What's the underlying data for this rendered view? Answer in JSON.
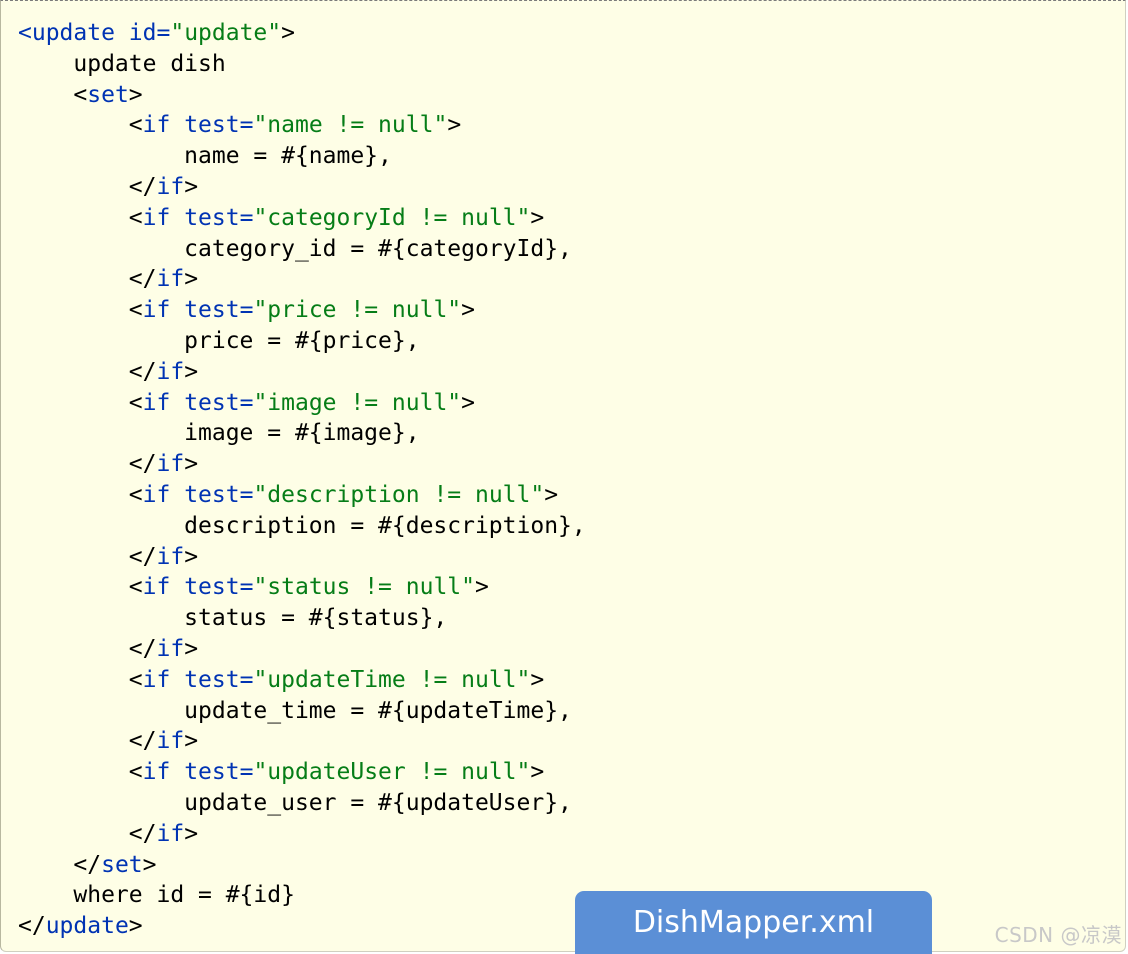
{
  "code": {
    "language": "xml",
    "lines": [
      [
        {
          "t": "tag",
          "v": "<update"
        },
        {
          "t": "text",
          "v": " "
        },
        {
          "t": "attr",
          "v": "id="
        },
        {
          "t": "str",
          "v": "\"update\""
        },
        {
          "t": "text",
          "v": ">"
        }
      ],
      [
        {
          "t": "text",
          "v": "    update dish"
        }
      ],
      [
        {
          "t": "text",
          "v": "    <"
        },
        {
          "t": "tag",
          "v": "set"
        },
        {
          "t": "text",
          "v": ">"
        }
      ],
      [
        {
          "t": "text",
          "v": "        <"
        },
        {
          "t": "tag",
          "v": "if"
        },
        {
          "t": "text",
          "v": " "
        },
        {
          "t": "attr",
          "v": "test="
        },
        {
          "t": "str",
          "v": "\"name != null\""
        },
        {
          "t": "text",
          "v": ">"
        }
      ],
      [
        {
          "t": "text",
          "v": "            name = #{name},"
        }
      ],
      [
        {
          "t": "text",
          "v": "        </"
        },
        {
          "t": "tag",
          "v": "if"
        },
        {
          "t": "text",
          "v": ">"
        }
      ],
      [
        {
          "t": "text",
          "v": "        <"
        },
        {
          "t": "tag",
          "v": "if"
        },
        {
          "t": "text",
          "v": " "
        },
        {
          "t": "attr",
          "v": "test="
        },
        {
          "t": "str",
          "v": "\"categoryId != null\""
        },
        {
          "t": "text",
          "v": ">"
        }
      ],
      [
        {
          "t": "text",
          "v": "            category_id = #{categoryId},"
        }
      ],
      [
        {
          "t": "text",
          "v": "        </"
        },
        {
          "t": "tag",
          "v": "if"
        },
        {
          "t": "text",
          "v": ">"
        }
      ],
      [
        {
          "t": "text",
          "v": "        <"
        },
        {
          "t": "tag",
          "v": "if"
        },
        {
          "t": "text",
          "v": " "
        },
        {
          "t": "attr",
          "v": "test="
        },
        {
          "t": "str",
          "v": "\"price != null\""
        },
        {
          "t": "text",
          "v": ">"
        }
      ],
      [
        {
          "t": "text",
          "v": "            price = #{price},"
        }
      ],
      [
        {
          "t": "text",
          "v": "        </"
        },
        {
          "t": "tag",
          "v": "if"
        },
        {
          "t": "text",
          "v": ">"
        }
      ],
      [
        {
          "t": "text",
          "v": "        <"
        },
        {
          "t": "tag",
          "v": "if"
        },
        {
          "t": "text",
          "v": " "
        },
        {
          "t": "attr",
          "v": "test="
        },
        {
          "t": "str",
          "v": "\"image != null\""
        },
        {
          "t": "text",
          "v": ">"
        }
      ],
      [
        {
          "t": "text",
          "v": "            image = #{image},"
        }
      ],
      [
        {
          "t": "text",
          "v": "        </"
        },
        {
          "t": "tag",
          "v": "if"
        },
        {
          "t": "text",
          "v": ">"
        }
      ],
      [
        {
          "t": "text",
          "v": "        <"
        },
        {
          "t": "tag",
          "v": "if"
        },
        {
          "t": "text",
          "v": " "
        },
        {
          "t": "attr",
          "v": "test="
        },
        {
          "t": "str",
          "v": "\"description != null\""
        },
        {
          "t": "text",
          "v": ">"
        }
      ],
      [
        {
          "t": "text",
          "v": "            description = #{description},"
        }
      ],
      [
        {
          "t": "text",
          "v": "        </"
        },
        {
          "t": "tag",
          "v": "if"
        },
        {
          "t": "text",
          "v": ">"
        }
      ],
      [
        {
          "t": "text",
          "v": "        <"
        },
        {
          "t": "tag",
          "v": "if"
        },
        {
          "t": "text",
          "v": " "
        },
        {
          "t": "attr",
          "v": "test="
        },
        {
          "t": "str",
          "v": "\"status != null\""
        },
        {
          "t": "text",
          "v": ">"
        }
      ],
      [
        {
          "t": "text",
          "v": "            status = #{status},"
        }
      ],
      [
        {
          "t": "text",
          "v": "        </"
        },
        {
          "t": "tag",
          "v": "if"
        },
        {
          "t": "text",
          "v": ">"
        }
      ],
      [
        {
          "t": "text",
          "v": "        <"
        },
        {
          "t": "tag",
          "v": "if"
        },
        {
          "t": "text",
          "v": " "
        },
        {
          "t": "attr",
          "v": "test="
        },
        {
          "t": "str",
          "v": "\"updateTime != null\""
        },
        {
          "t": "text",
          "v": ">"
        }
      ],
      [
        {
          "t": "text",
          "v": "            update_time = #{updateTime},"
        }
      ],
      [
        {
          "t": "text",
          "v": "        </"
        },
        {
          "t": "tag",
          "v": "if"
        },
        {
          "t": "text",
          "v": ">"
        }
      ],
      [
        {
          "t": "text",
          "v": "        <"
        },
        {
          "t": "tag",
          "v": "if"
        },
        {
          "t": "text",
          "v": " "
        },
        {
          "t": "attr",
          "v": "test="
        },
        {
          "t": "str",
          "v": "\"updateUser != null\""
        },
        {
          "t": "text",
          "v": ">"
        }
      ],
      [
        {
          "t": "text",
          "v": "            update_user = #{updateUser},"
        }
      ],
      [
        {
          "t": "text",
          "v": "        </"
        },
        {
          "t": "tag",
          "v": "if"
        },
        {
          "t": "text",
          "v": ">"
        }
      ],
      [
        {
          "t": "text",
          "v": "    </"
        },
        {
          "t": "tag",
          "v": "set"
        },
        {
          "t": "text",
          "v": ">"
        }
      ],
      [
        {
          "t": "text",
          "v": "    where id = #{id}"
        }
      ],
      [
        {
          "t": "text",
          "v": "</"
        },
        {
          "t": "tag",
          "v": "update"
        },
        {
          "t": "text",
          "v": ">"
        }
      ]
    ]
  },
  "file_badge": {
    "label": "DishMapper.xml"
  },
  "watermark": {
    "text": "CSDN @凉漠"
  },
  "colors": {
    "background": "#fefee6",
    "tag": "#0033b3",
    "string": "#067d17",
    "text": "#000000",
    "badge": "#5b8fd6"
  }
}
